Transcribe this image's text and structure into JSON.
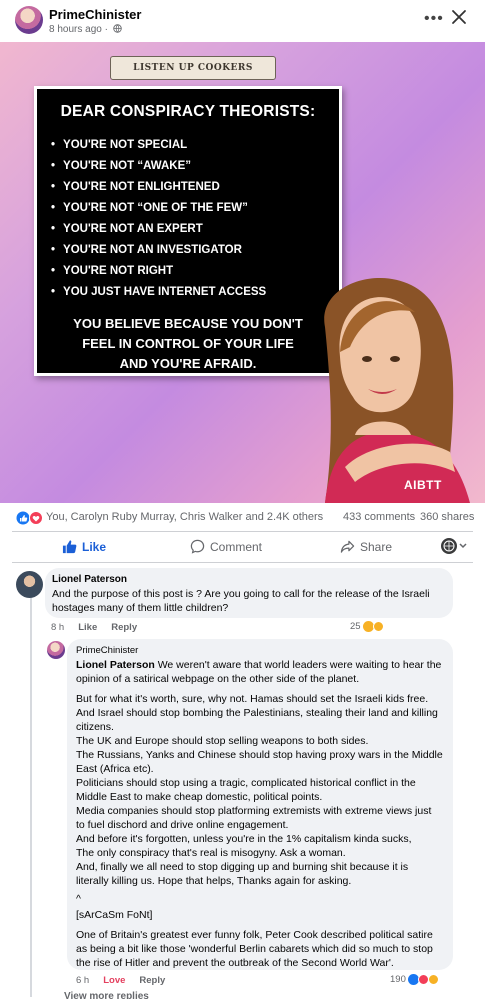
{
  "post": {
    "author": "PrimeChinister",
    "time": "8 hours ago ·"
  },
  "image": {
    "banner": "LISTEN UP COOKERS",
    "title": "DEAR CONSPIRACY THEORISTS:",
    "items": [
      "YOU'RE NOT SPECIAL",
      "YOU'RE NOT “AWAKE”",
      "YOU'RE NOT ENLIGHTENED",
      "YOU'RE NOT “ONE OF THE FEW”",
      "YOU'RE NOT AN EXPERT",
      "YOU'RE NOT AN INVESTIGATOR",
      "YOU'RE NOT RIGHT",
      "YOU JUST HAVE INTERNET ACCESS"
    ],
    "footer_line1": "YOU BELIEVE BECAUSE YOU DON'T",
    "footer_line2": "FEEL IN CONTROL OF YOUR LIFE",
    "footer_line3": "AND YOU'RE AFRAID.",
    "watermark": "AIBTT"
  },
  "stats": {
    "reactions": "You, Carolyn Ruby Murray, Chris Walker and 2.4K others",
    "comments": "433 comments",
    "shares": "360 shares"
  },
  "actions": {
    "like": "Like",
    "comment": "Comment",
    "share": "Share"
  },
  "comment1": {
    "author": "Lionel Paterson",
    "text": "And the purpose of this post is ? Are you going to call for the release of the Israeli hostages many of them little children?",
    "time": "8 h",
    "like": "Like",
    "reply": "Reply",
    "reaction_count": "25"
  },
  "reply1": {
    "author": "PrimeChinister",
    "mention": "Lionel Paterson",
    "intro": "We weren't aware that world leaders were waiting to hear the opinion of a satirical webpage on the other side of the planet.",
    "para1": "But for what it's worth, sure, why not. Hamas should set the Israeli kids free. And Israel should stop bombing the Palestinians, stealing their land and killing citizens.",
    "para2": "The UK and Europe should stop selling weapons to both sides.",
    "para3": "The Russians, Yanks and Chinese should stop having proxy wars in the Middle East (Africa etc).",
    "para4": "Politicians should stop using a tragic, complicated historical conflict in the Middle East to make cheap domestic, political points.",
    "para5": "Media companies should stop platforming extremists with extreme views just to fuel dischord and drive online engagement.",
    "para6": "And before it's forgotten, unless you're in the 1% capitalism kinda sucks,",
    "para7": "The only conspiracy that's real is misogyny. Ask a woman.",
    "para8": "And, finally we all need to stop digging up and burning shit because it is literally killing us. Hope that helps, Thanks again for asking.",
    "caret": "^",
    "sarcasm": "[sArCaSm FoNt]",
    "para9": "One of Britain's greatest ever funny folk, Peter Cook described political satire as being a bit like those 'wonderful Berlin cabarets which did so much to stop the rise of Hitler and prevent the outbreak of the Second World War'.",
    "time": "6 h",
    "love": "Love",
    "reply": "Reply",
    "reaction_count": "190"
  },
  "view_more": "View more replies",
  "colors": {
    "like_blue": "#1b5fd6",
    "love_red": "#e4405f",
    "muted": "#65676b",
    "bubble": "#f0f2f5"
  },
  "icons": [
    "globe-icon",
    "more-icon",
    "close-icon",
    "like-reaction-icon",
    "love-reaction-icon",
    "thumbs-up-icon",
    "comment-icon",
    "share-icon",
    "audience-icon"
  ]
}
